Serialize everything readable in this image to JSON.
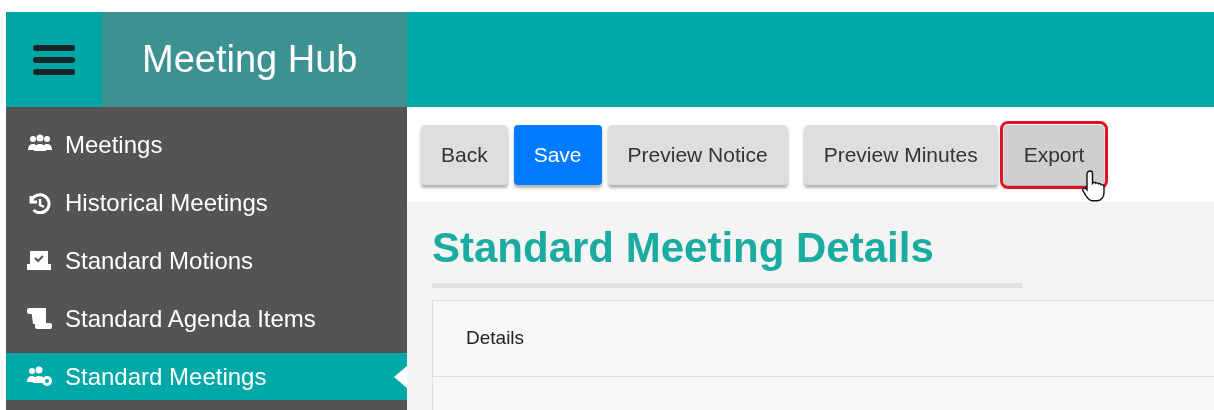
{
  "header": {
    "title": "Meeting Hub"
  },
  "sidebar": {
    "items": [
      {
        "label": "Meetings",
        "selected": false
      },
      {
        "label": "Historical Meetings",
        "selected": false
      },
      {
        "label": "Standard Motions",
        "selected": false
      },
      {
        "label": "Standard Agenda Items",
        "selected": false
      },
      {
        "label": "Standard Meetings",
        "selected": true
      }
    ]
  },
  "toolbar": {
    "buttons": [
      {
        "label": "Back",
        "kind": "default",
        "highlighted": false
      },
      {
        "label": "Save",
        "kind": "primary",
        "highlighted": false
      },
      {
        "label": "Preview Notice",
        "kind": "default",
        "highlighted": false
      },
      {
        "label": "Preview Minutes",
        "kind": "default",
        "highlighted": false
      },
      {
        "label": "Export",
        "kind": "default",
        "highlighted": true
      }
    ]
  },
  "page": {
    "title": "Standard Meeting Details",
    "card": {
      "header": "Details"
    }
  }
}
